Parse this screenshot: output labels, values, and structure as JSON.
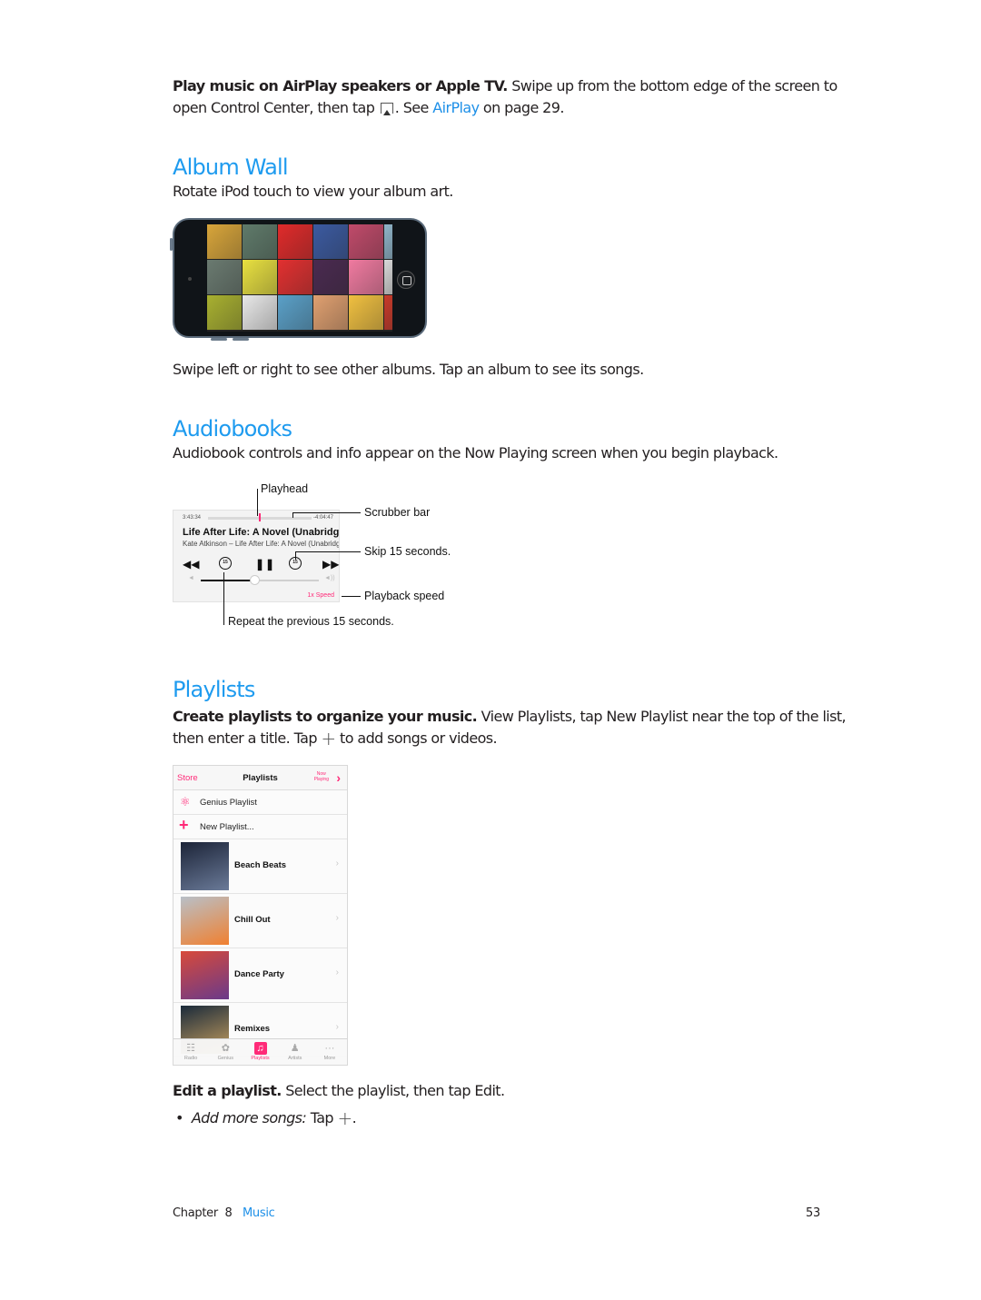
{
  "intro": {
    "bold": "Play music on AirPlay speakers or Apple TV.",
    "text1": " Swipe up from the bottom edge of the screen to",
    "text2": "open Control Center, then tap ",
    "text3": ". See ",
    "link": "AirPlay",
    "text4": " on page 29.",
    "icon": "airplay-icon"
  },
  "album_wall": {
    "heading": "Album Wall",
    "body": "Rotate iPod touch to view your album art.",
    "caption": "Swipe left or right to see other albums. Tap an album to see its songs.",
    "tile_colors": [
      "#d8a53a",
      "#5f7a6a",
      "#e02a2a",
      "#3b5aa0",
      "#c04a6a",
      "#8fb4c8",
      "#6a7a70",
      "#e8e040",
      "#e23030",
      "#4a2a50",
      "#f07aa0",
      "#d8d8d8",
      "#a8b030",
      "#e8e8e8",
      "#5aa0c8",
      "#e0a070",
      "#f0c040",
      "#c83a2a"
    ]
  },
  "audiobooks": {
    "heading": "Audiobooks",
    "body": "Audiobook controls and info appear on the Now Playing screen when you begin playback.",
    "player": {
      "elapsed": "3:43:34",
      "remaining": "-4:04:47",
      "title": "Life After Life: A Novel (Unabridged)",
      "subtitle": "Kate Atkinson – Life After Life: A Novel (Unabridged)",
      "skip_seconds": "15",
      "speed": "1x Speed",
      "progress": 0.48,
      "volume": 0.45
    },
    "callouts": {
      "playhead": "Playhead",
      "scrubber": "Scrubber bar",
      "skip": "Skip 15 seconds.",
      "speed": "Playback speed",
      "repeat": "Repeat the previous 15 seconds."
    }
  },
  "playlists": {
    "heading": "Playlists",
    "p1_bold": "Create playlists to organize your music.",
    "p1_text": " View Playlists, tap New Playlist near the top of the list,",
    "p1_text2a": "then enter a title. Tap ",
    "p1_text2b": " to add songs or videos.",
    "plus_glyph": "+",
    "screen": {
      "store": "Store",
      "title": "Playlists",
      "now_playing_1": "Now",
      "now_playing_2": "Playing",
      "genius": "Genius Playlist",
      "new_playlist": "New Playlist...",
      "items": [
        {
          "label": "Beach Beats",
          "art": [
            "#1c2438",
            "#6a7a98"
          ]
        },
        {
          "label": "Chill Out",
          "art": [
            "#b8c0c8",
            "#f08030"
          ]
        },
        {
          "label": "Dance Party",
          "art": [
            "#d84a3a",
            "#6a3a8a"
          ]
        },
        {
          "label": "Remixes",
          "art": [
            "#1a2a3a",
            "#c8a060"
          ]
        }
      ],
      "tabs": [
        {
          "label": "Radio",
          "icon": "☷"
        },
        {
          "label": "Genius",
          "icon": "✿"
        },
        {
          "label": "Playlists",
          "icon": "♫",
          "active": true
        },
        {
          "label": "Artists",
          "icon": "♟"
        },
        {
          "label": "More",
          "icon": "···"
        }
      ]
    },
    "edit_bold": "Edit a playlist.",
    "edit_text": " Select the playlist, then tap Edit.",
    "bullet_italic": "Add more songs:",
    "bullet_text": " Tap ",
    "bullet_end": "."
  },
  "footer": {
    "chapter": "Chapter  8",
    "chapter_name": "Music",
    "page": "53"
  }
}
